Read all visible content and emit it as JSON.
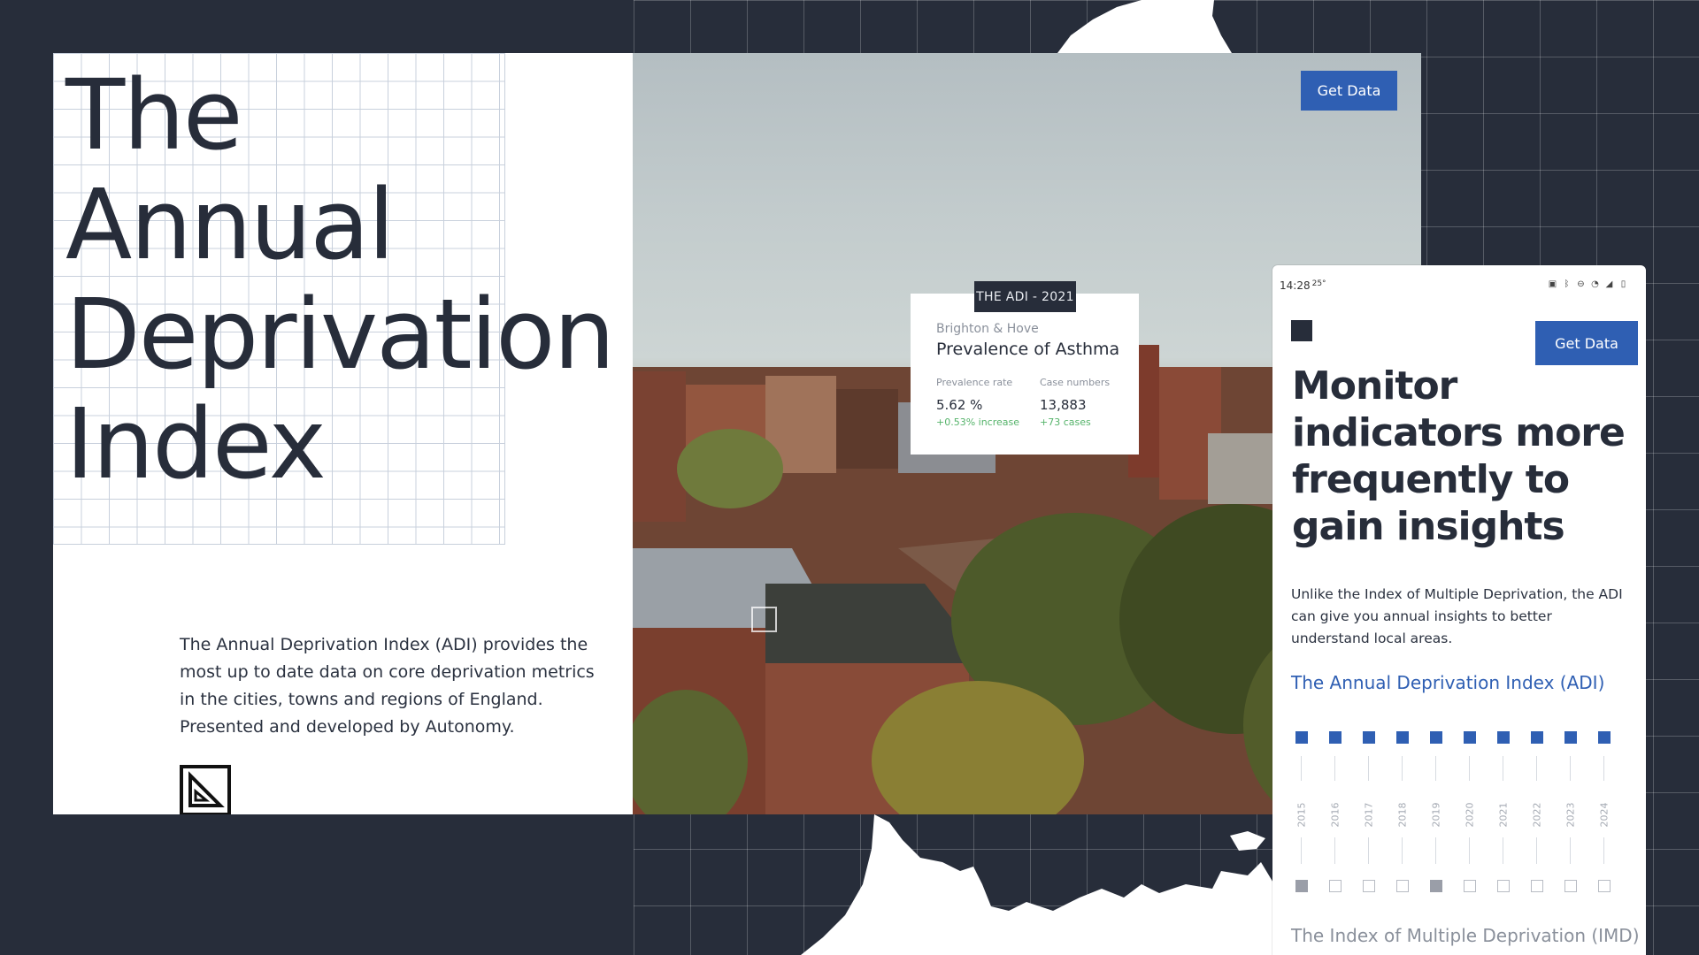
{
  "left_card": {
    "title_lines": [
      "The",
      "Annual",
      "Deprivation",
      "Index"
    ],
    "intro": "The Annual Deprivation Index (ADI) provides the most up to date data on core deprivation metrics in the cities, towns and regions of England. Presented and developed by Autonomy.",
    "logo_icon": "set-square-icon"
  },
  "photo_panel": {
    "get_data_label": "Get Data",
    "stat_card": {
      "tag": "THE ADI - 2021",
      "place": "Brighton & Hove",
      "title": "Prevalence of Asthma",
      "columns": [
        {
          "label": "Prevalence rate",
          "value": "5.62 %",
          "change": "+0.53% increase"
        },
        {
          "label": "Case numbers",
          "value": "13,883",
          "change": "+73 cases"
        }
      ]
    }
  },
  "phone": {
    "status": {
      "time": "14:28",
      "temp": "25°",
      "icons": [
        "nfc-icon",
        "bluetooth-icon",
        "dnd-icon",
        "wifi-icon",
        "signal-icon",
        "battery-icon"
      ]
    },
    "get_data_label": "Get Data",
    "headline": "Monitor indicators more frequently to gain insights",
    "paragraph": "Unlike the Index of Multiple Deprivation, the ADI can give you annual insights to better understand local areas.",
    "adi_heading": "The Annual Deprivation Index (ADI)",
    "imd_heading": "The Index of Multiple Deprivation (IMD)",
    "timeline": {
      "years": [
        "2015",
        "2016",
        "2017",
        "2018",
        "2019",
        "2020",
        "2021",
        "2022",
        "2023",
        "2024"
      ],
      "adi_available": [
        true,
        true,
        true,
        true,
        true,
        true,
        true,
        true,
        true,
        true
      ],
      "imd_available": [
        true,
        false,
        false,
        false,
        true,
        false,
        false,
        false,
        false,
        false
      ]
    }
  },
  "colors": {
    "background": "#272d3a",
    "accent": "#2f5fb3",
    "positive": "#55b36a"
  }
}
